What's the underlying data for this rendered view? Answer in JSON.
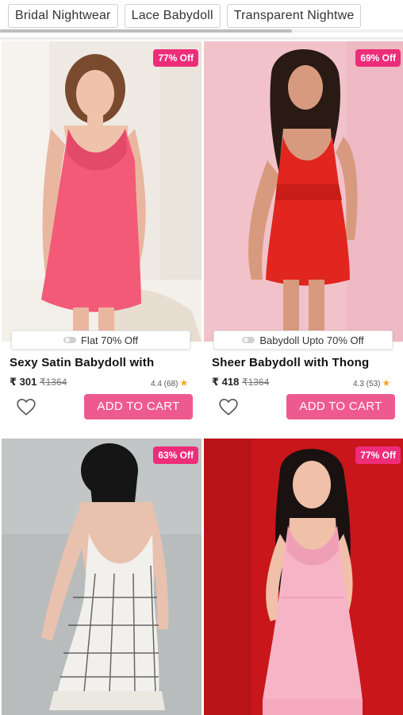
{
  "chips": [
    "Bridal Nightwear",
    "Lace Babydoll",
    "Transparent Nightwe"
  ],
  "colors": {
    "accent": "#ee2d7a",
    "button": "#ee5a8f",
    "star": "#f5a623"
  },
  "products": [
    {
      "discount": "77% Off",
      "offer": "Flat 70% Off",
      "name": "Sexy Satin Babydoll with",
      "price": "₹ 301",
      "mrp": "₹1364",
      "rating": "4.4 (68)",
      "cta": "ADD TO CART"
    },
    {
      "discount": "69% Off",
      "offer": "Babydoll Upto 70% Off",
      "name": "Sheer Babydoll with Thong",
      "price": "₹ 418",
      "mrp": "₹1364",
      "rating": "4.3 (53)",
      "cta": "ADD TO CART"
    },
    {
      "discount": "63% Off"
    },
    {
      "discount": "77% Off"
    }
  ]
}
